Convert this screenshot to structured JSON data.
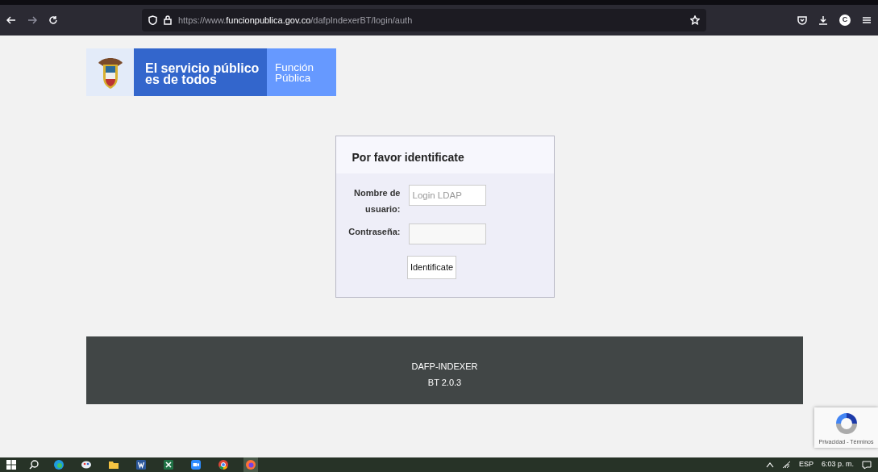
{
  "browser": {
    "address_bar": {
      "scheme": "https://www.",
      "domain": "funcionpublica.gov.co",
      "path": "/dafpIndexerBT/login/auth"
    },
    "profile_initial": "C"
  },
  "logo": {
    "slogan_line_1": "El servicio público",
    "slogan_line_2": "es de todos",
    "entity_line_1": "Función",
    "entity_line_2": "Pública"
  },
  "login": {
    "title": "Por favor identificate",
    "fields": [
      {
        "label": "Nombre de usuario:",
        "placeholder": "Login LDAP",
        "kind": "text"
      },
      {
        "label": "Contraseña:",
        "kind": "password"
      }
    ],
    "submit": "Identificate"
  },
  "footer": {
    "lines": [
      "DAFP-INDEXER",
      "BT 2.0.3"
    ]
  },
  "recaptcha": {
    "links": "Privacidad - Términos"
  },
  "taskbar": {
    "apps": [
      {
        "kind": "edge",
        "selected": false
      },
      {
        "kind": "paint",
        "selected": false
      },
      {
        "kind": "folder",
        "selected": false
      },
      {
        "kind": "word",
        "selected": false
      },
      {
        "kind": "excel",
        "selected": false
      },
      {
        "kind": "zoom",
        "selected": false
      },
      {
        "kind": "chrome",
        "selected": false
      },
      {
        "kind": "firefox",
        "selected": true
      }
    ],
    "language": "ESP",
    "time": "6:03 p. m."
  }
}
